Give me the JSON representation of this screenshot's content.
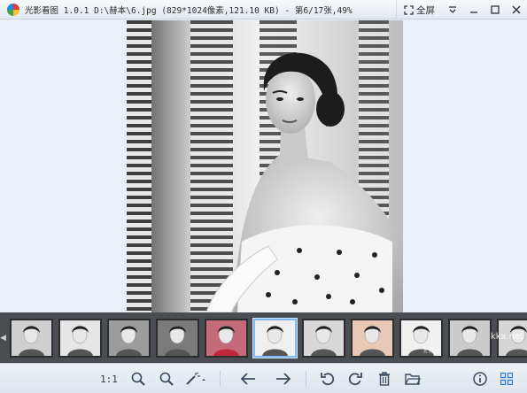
{
  "window": {
    "app_name": "光影看图",
    "version": "1.0.1",
    "file_path": "D:\\赫本\\6.jpg",
    "file_info": "(829*1024像素,121.10 KB)",
    "position": "- 第6/17张,49%",
    "fullscreen_label": "全屏"
  },
  "filmstrip": {
    "current_index": 5,
    "thumbnails": [
      {
        "name": "thumb-1"
      },
      {
        "name": "thumb-2"
      },
      {
        "name": "thumb-3"
      },
      {
        "name": "thumb-4"
      },
      {
        "name": "thumb-5"
      },
      {
        "name": "thumb-6"
      },
      {
        "name": "thumb-7"
      },
      {
        "name": "thumb-8"
      },
      {
        "name": "thumb-9"
      },
      {
        "name": "thumb-10"
      },
      {
        "name": "thumb-11"
      }
    ]
  },
  "toolbar": {
    "ratio_label": "1:1",
    "icons": [
      "zoom-in-icon",
      "zoom-out-icon",
      "magic-wand-icon",
      "arrow-left-icon",
      "arrow-right-icon",
      "rotate-left-icon",
      "rotate-right-icon",
      "trash-icon",
      "folder-icon",
      "info-icon",
      "grid-icon"
    ]
  },
  "watermark": "kkx.net",
  "watermark_brand": "kkx"
}
